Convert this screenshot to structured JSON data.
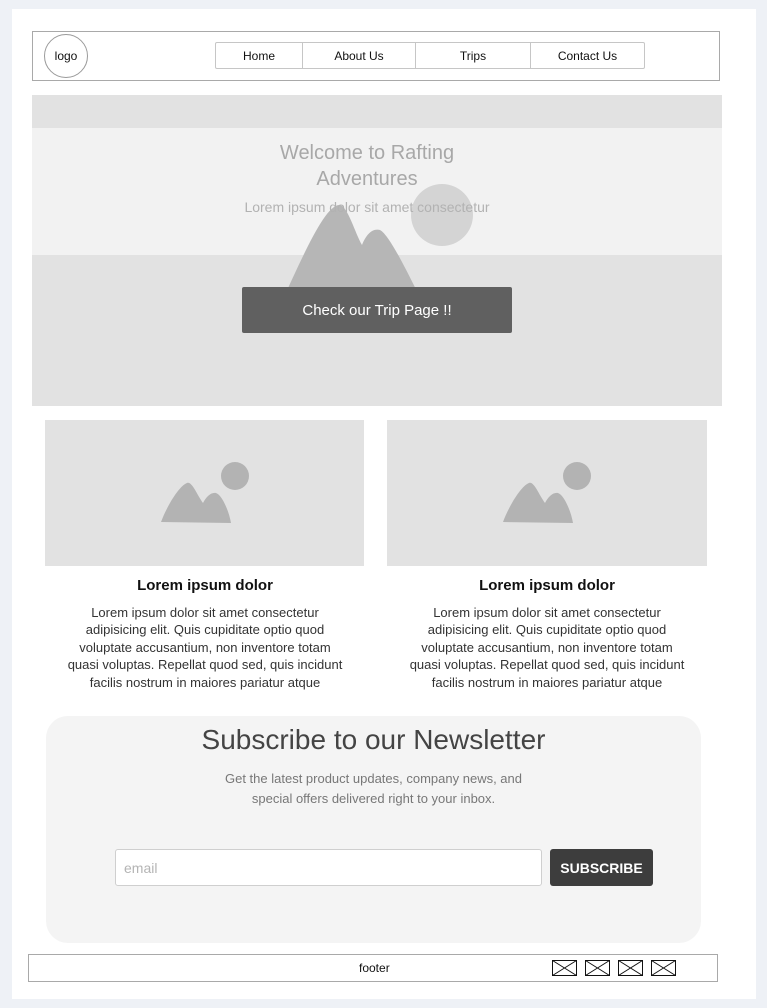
{
  "header": {
    "logo": "logo",
    "nav": [
      "Home",
      "About Us",
      "Trips",
      "Contact Us"
    ]
  },
  "hero": {
    "title": "Welcome to Rafting Adventures",
    "subtitle": "Lorem ipsum dolor sit amet consectetur",
    "cta_label": "Check our Trip Page !!",
    "image_icon": "image-placeholder-icon"
  },
  "cards": [
    {
      "title": "Lorem ipsum dolor",
      "text": "Lorem ipsum dolor sit amet consectetur adipisicing elit. Quis cupiditate optio quod voluptate accusantium, non inventore totam quasi voluptas. Repellat quod sed, quis incidunt facilis nostrum in maiores pariatur atque",
      "image_icon": "image-placeholder-icon"
    },
    {
      "title": "Lorem ipsum dolor",
      "text": "Lorem ipsum dolor sit amet consectetur adipisicing elit. Quis cupiditate optio quod voluptate accusantium, non inventore totam quasi voluptas. Repellat quod sed, quis incidunt facilis nostrum in maiores pariatur atque",
      "image_icon": "image-placeholder-icon"
    }
  ],
  "newsletter": {
    "title": "Subscribe to our Newsletter",
    "subtitle": "Get the latest product updates, company news, and special offers delivered right to your inbox.",
    "email_placeholder": "email",
    "email_value": "",
    "button_label": "SUBSCRIBE"
  },
  "footer": {
    "label": "footer",
    "icons": [
      "social-icon-placeholder",
      "social-icon-placeholder",
      "social-icon-placeholder",
      "social-icon-placeholder"
    ]
  },
  "colors": {
    "cta": "#606060",
    "subscribe": "#3d3d3d",
    "placeholder_fill": "#e2e2e2"
  }
}
